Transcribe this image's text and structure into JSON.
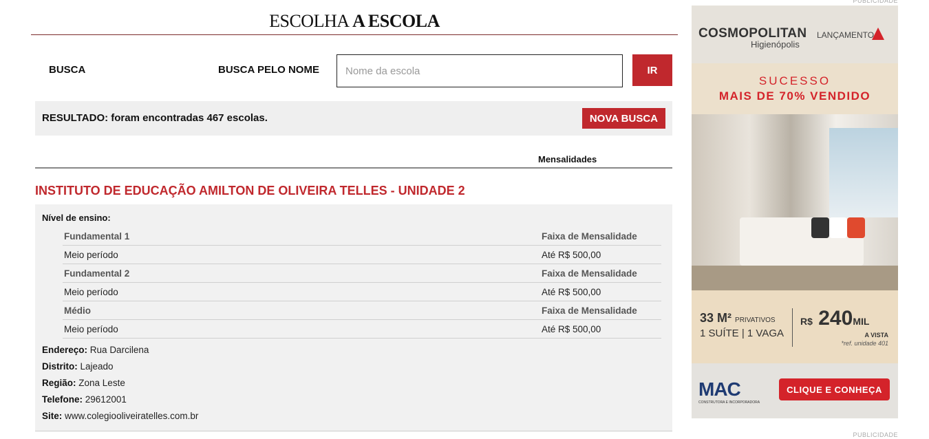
{
  "header": {
    "title_prefix": "ESCOLHA",
    "title_bold": "A ESCOLA"
  },
  "search": {
    "section_label": "BUSCA",
    "by_name_label": "BUSCA PELO NOME",
    "placeholder": "Nome da escola",
    "value": "",
    "submit_label": "IR"
  },
  "results": {
    "summary": "RESULTADO: foram encontradas 467 escolas.",
    "new_search_label": "NOVA BUSCA",
    "column_header": "Mensalidades"
  },
  "school": {
    "name": "INSTITUTO DE EDUCAÇÃO AMILTON DE OLIVEIRA TELLES - UNIDADE 2",
    "levels_label": "Nível de ensino:",
    "levels": [
      {
        "name": "Fundamental 1",
        "range_header": "Faixa de Mensalidade",
        "period": "Meio período",
        "price": "Até R$ 500,00"
      },
      {
        "name": "Fundamental 2",
        "range_header": "Faixa de Mensalidade",
        "period": "Meio período",
        "price": "Até R$ 500,00"
      },
      {
        "name": "Médio",
        "range_header": "Faixa de Mensalidade",
        "period": "Meio período",
        "price": "Até R$ 500,00"
      }
    ],
    "details": [
      {
        "label": "Endereço:",
        "value": "Rua Darcilena"
      },
      {
        "label": "Distrito:",
        "value": "Lajeado"
      },
      {
        "label": "Região:",
        "value": "Zona Leste"
      },
      {
        "label": "Telefone:",
        "value": "29612001"
      },
      {
        "label": "Site:",
        "value": "www.colegiooliveiratelles.com.br"
      }
    ]
  },
  "ad": {
    "label": "PUBLICIDADE",
    "brand": "COSMOPOLITAN",
    "brand_sub": "Higienópolis",
    "launch": "LANÇAMENTO",
    "success": "SUCESSO",
    "sold": "MAIS DE 70% VENDIDO",
    "area": "33 M²",
    "area_sub": "PRIVATIVOS",
    "rooms": "1 SUÍTE  | 1 VAGA",
    "price_prefix": "R$",
    "price": "240",
    "price_suffix": "MIL",
    "payment": "A VISTA",
    "ref": "*ref. unidade 401",
    "developer": "MAC",
    "developer_sub": "CONSTRUTORA E INCORPORADORA",
    "cta": "CLIQUE E CONHEÇA",
    "colors": {
      "accent": "#d4232a",
      "brand_blue": "#1f3b73"
    }
  },
  "colors": {
    "primary": "#c0282d",
    "panel": "#efefef"
  }
}
